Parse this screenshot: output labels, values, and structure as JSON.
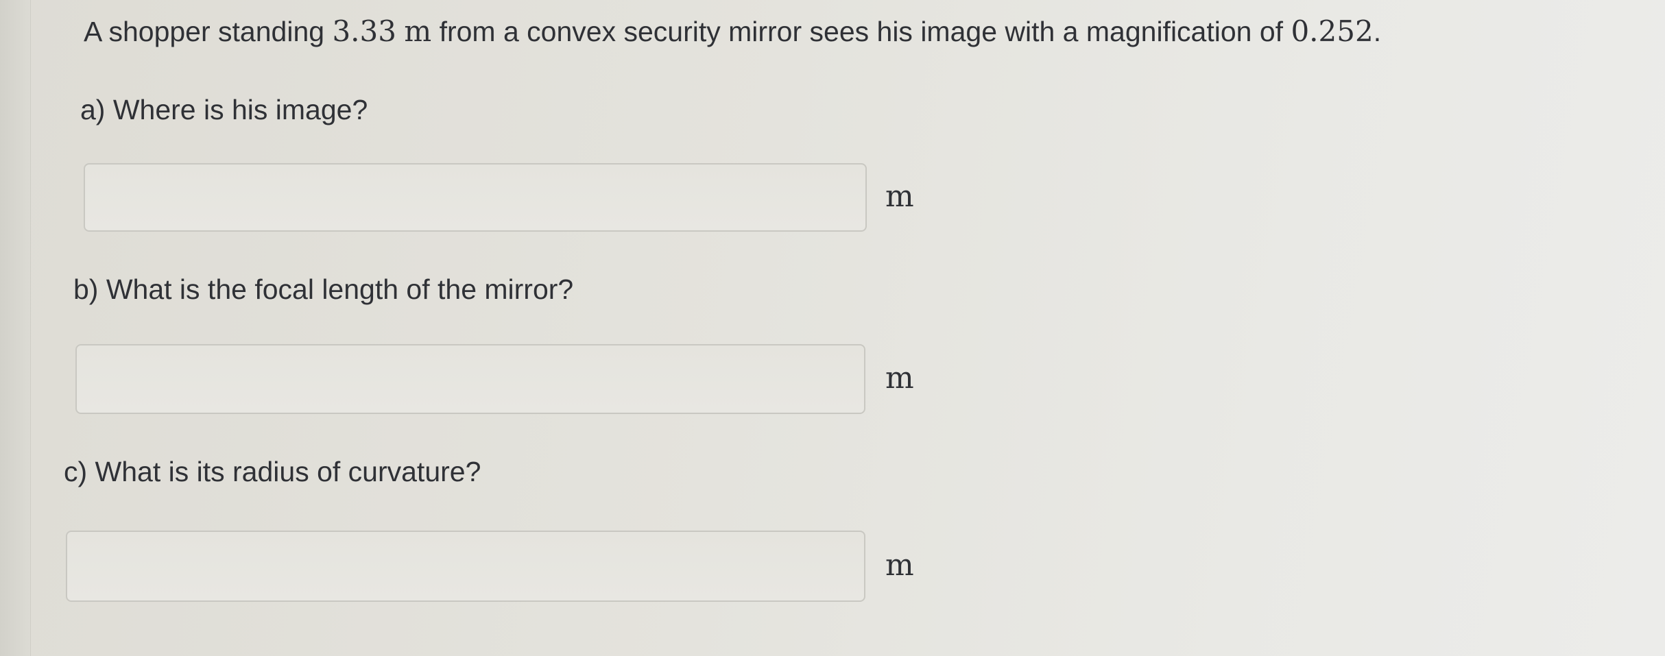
{
  "problem": {
    "text_before_distance": "A shopper standing ",
    "distance": "3.33",
    "distance_unit": "m",
    "text_after_distance": " from a convex security mirror sees his image with a magnification of ",
    "magnification": "0.252",
    "end_punctuation": "."
  },
  "parts": [
    {
      "label": "a) Where is his image?",
      "answer_value": "",
      "unit": "m"
    },
    {
      "label": "b) What is the focal length of the mirror?",
      "answer_value": "",
      "unit": "m"
    },
    {
      "label": "c) What is its radius of curvature?",
      "answer_value": "",
      "unit": "m"
    }
  ]
}
